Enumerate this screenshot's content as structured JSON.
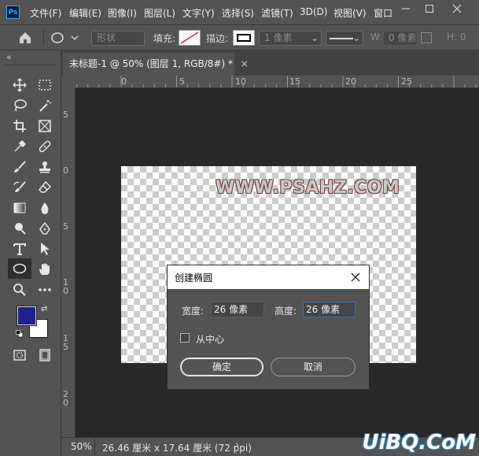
{
  "app": {
    "logo_text": "Ps"
  },
  "menubar": {
    "items": [
      "文件(F)",
      "编辑(E)",
      "图像(I)",
      "图层(L)",
      "文字(Y)",
      "选择(S)",
      "滤镜(T)",
      "3D(D)",
      "视图(V)",
      "窗口"
    ]
  },
  "options": {
    "mode_value": "形状",
    "fill_label": "填充:",
    "stroke_label": "描边:",
    "stroke_width_value": "1 像素",
    "w_label": "W:",
    "w_value": "0 像素",
    "h_label": "H:",
    "h_value": "0"
  },
  "document": {
    "tab_title": "未标题-1 @ 50% (图层 1, RGB/8#) *",
    "tab_close": "×",
    "hruler_ticks": [
      "0",
      "5",
      "10",
      "15",
      "20",
      "25"
    ],
    "vruler_ticks": [
      "5",
      "0",
      "5",
      "1 0",
      "1 5",
      "2 0"
    ],
    "canvas_text": "WWW.PSAHZ.COM"
  },
  "colors": {
    "foreground": "#1f1f8f",
    "background": "#ffffff"
  },
  "status": {
    "zoom": "50%",
    "doc_info": "26.46 厘米 x 17.64 厘米 (72 ppi)",
    "arrow": "›"
  },
  "dialog": {
    "title": "创建椭圆",
    "width_label": "宽度:",
    "width_value": "26 像素",
    "height_label": "高度:",
    "height_value": "26 像素",
    "from_center_label": "从中心",
    "from_center_checked": false,
    "ok_label": "确定",
    "cancel_label": "取消"
  },
  "brand": {
    "watermark_text": "UiBQ.CoM"
  },
  "icons": [
    "home-icon",
    "ellipse-icon",
    "move-icon",
    "marquee-icon",
    "lasso-icon",
    "magic-wand-icon",
    "crop-icon",
    "frame-icon",
    "eyedropper-icon",
    "healing-icon",
    "brush-icon",
    "stamp-icon",
    "history-brush-icon",
    "eraser-icon",
    "gradient-icon",
    "blur-icon",
    "dodge-icon",
    "pen-icon",
    "type-icon",
    "path-select-icon",
    "ellipse-tool-icon",
    "hand-icon",
    "zoom-icon",
    "more-icon",
    "quick-mask-icon",
    "screen-mode-icon"
  ]
}
